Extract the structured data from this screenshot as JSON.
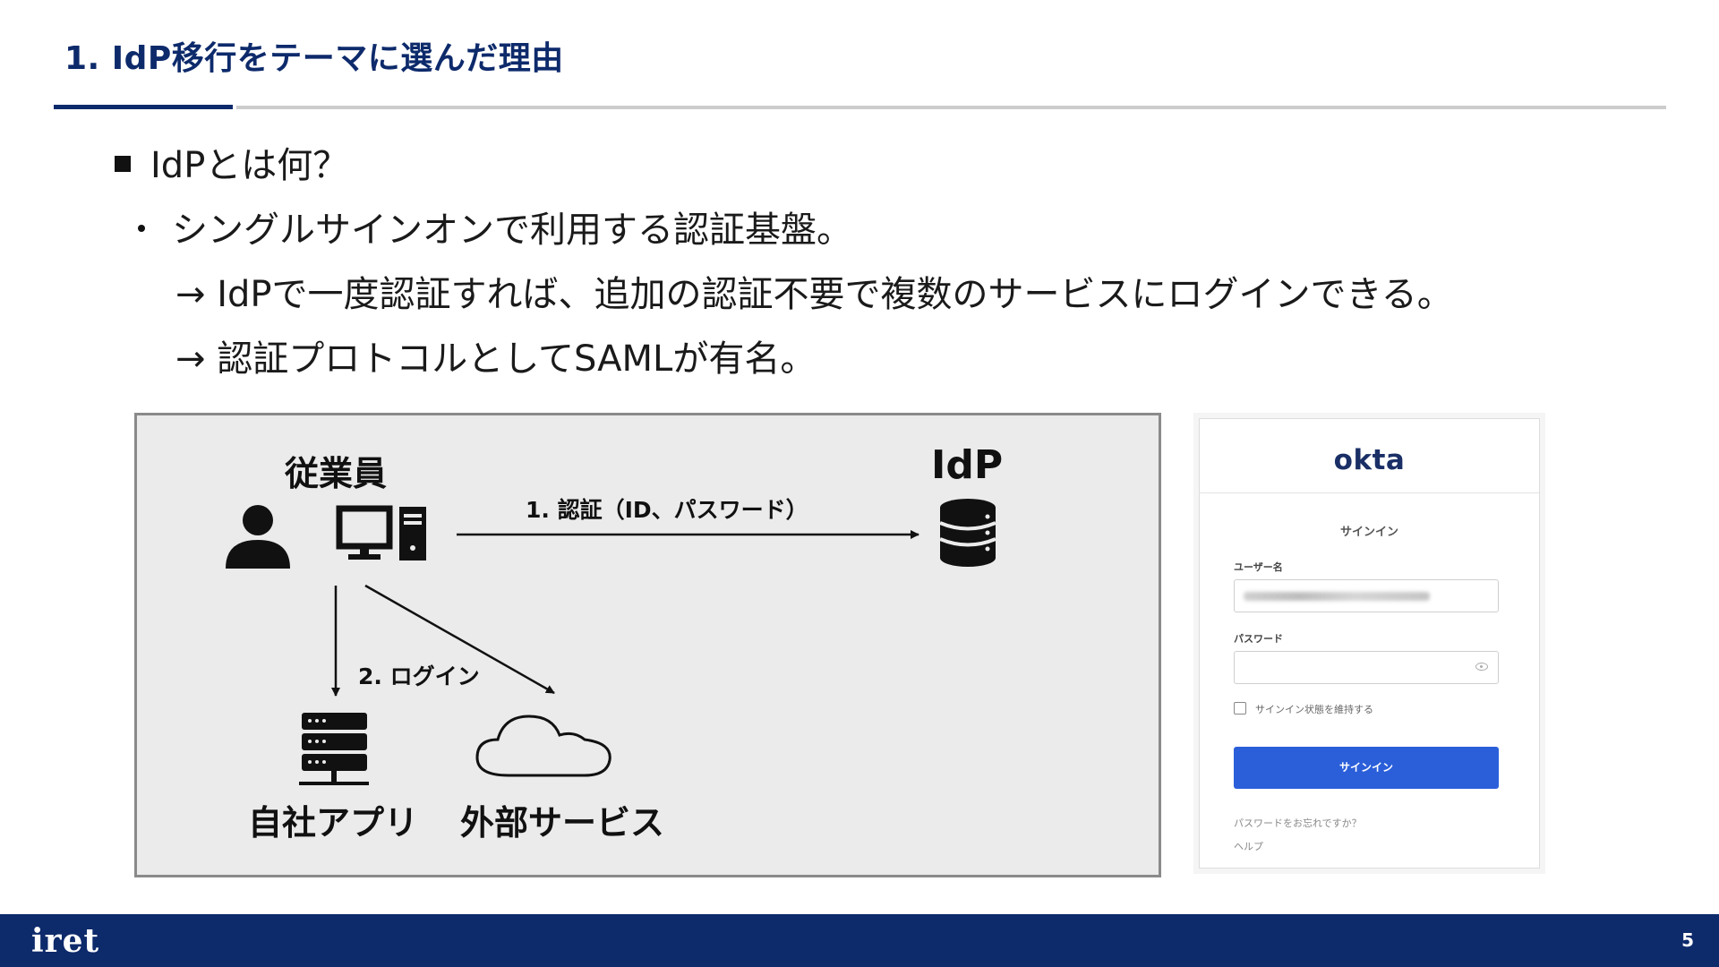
{
  "slide": {
    "title": "1.  IdP移行をテーマに選んだ理由",
    "page_number": "5"
  },
  "content": {
    "heading": "IdPとは何？",
    "bullet": "シングルサインオンで利用する認証基盤。",
    "arrow_line_1": "→ IdPで一度認証すれば、追加の認証不要で複数のサービスにログインできる。",
    "arrow_line_2": "→ 認証プロトコルとしてSAMLが有名。"
  },
  "diagram": {
    "employee_label": "従業員",
    "idp_label": "IdP",
    "auth_arrow_label": "1. 認証（ID、パスワード）",
    "login_arrow_label": "2. ログイン",
    "internal_app_label": "自社アプリ",
    "external_service_label": "外部サービス",
    "icons": [
      "person-icon",
      "desktop-computer-icon",
      "database-icon",
      "server-icon",
      "cloud-icon"
    ]
  },
  "okta_login": {
    "logo": "okta",
    "title": "サインイン",
    "username_label": "ユーザー名",
    "password_label": "パスワード",
    "remember_label": "サインイン状態を維持する",
    "signin_button": "サインイン",
    "forgot_link": "パスワードをお忘れですか？",
    "help_link": "ヘルプ",
    "accent_color": "#2b5fd9"
  },
  "footer": {
    "brand": "iret"
  },
  "colors": {
    "primary": "#0d2a6b",
    "diagram_bg": "#ebebeb"
  }
}
